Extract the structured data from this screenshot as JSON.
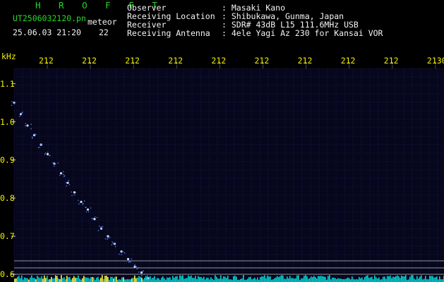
{
  "header": {
    "app_title": "H R O F F T",
    "file_name": "UT2506032120.pn",
    "tag": "meteor",
    "date_time": "25.06.03 21:20",
    "count": "22",
    "fields": [
      {
        "label": "Observer",
        "value": ": Masaki Kano"
      },
      {
        "label": "Receiving Location",
        "value": ": Shibukawa, Gunma, Japan"
      },
      {
        "label": "Receiver",
        "value": ": SDR# 43dB L15 111.6MHz USB"
      },
      {
        "label": "Receiving Antenna",
        "value": ": 4ele Yagi Az 230 for Kansai VOR"
      }
    ]
  },
  "chart_data": {
    "type": "scatter",
    "title": "",
    "ylabel": "kHz",
    "xlabel": "",
    "x_ticks": [
      "212",
      "212",
      "212",
      "212",
      "212",
      "212",
      "212",
      "212",
      "212",
      "2130"
    ],
    "y_ticks": [
      "1.1",
      "1.0",
      "0.9",
      "0.8",
      "0.7",
      "0.6"
    ],
    "ylim": [
      0.58,
      1.14
    ],
    "grid": true,
    "colors": {
      "background": "#06061c",
      "grid": "#2b2b6a",
      "signal": "#5a8cff",
      "axis_text": "#f0f000",
      "noise_floor": "#00d8d8"
    },
    "series": [
      {
        "x": [
          0.0,
          0.05,
          0.1,
          0.15,
          0.2,
          0.25,
          0.3,
          0.35,
          0.4,
          0.45,
          0.5,
          0.55,
          0.6,
          0.65,
          0.7,
          0.75,
          0.8,
          0.85,
          0.9,
          0.95,
          1.0
        ],
        "y": [
          1.05,
          1.02,
          0.99,
          0.965,
          0.94,
          0.915,
          0.89,
          0.865,
          0.84,
          0.815,
          0.79,
          0.77,
          0.745,
          0.72,
          0.7,
          0.68,
          0.66,
          0.64,
          0.62,
          0.605,
          0.59
        ]
      }
    ]
  }
}
